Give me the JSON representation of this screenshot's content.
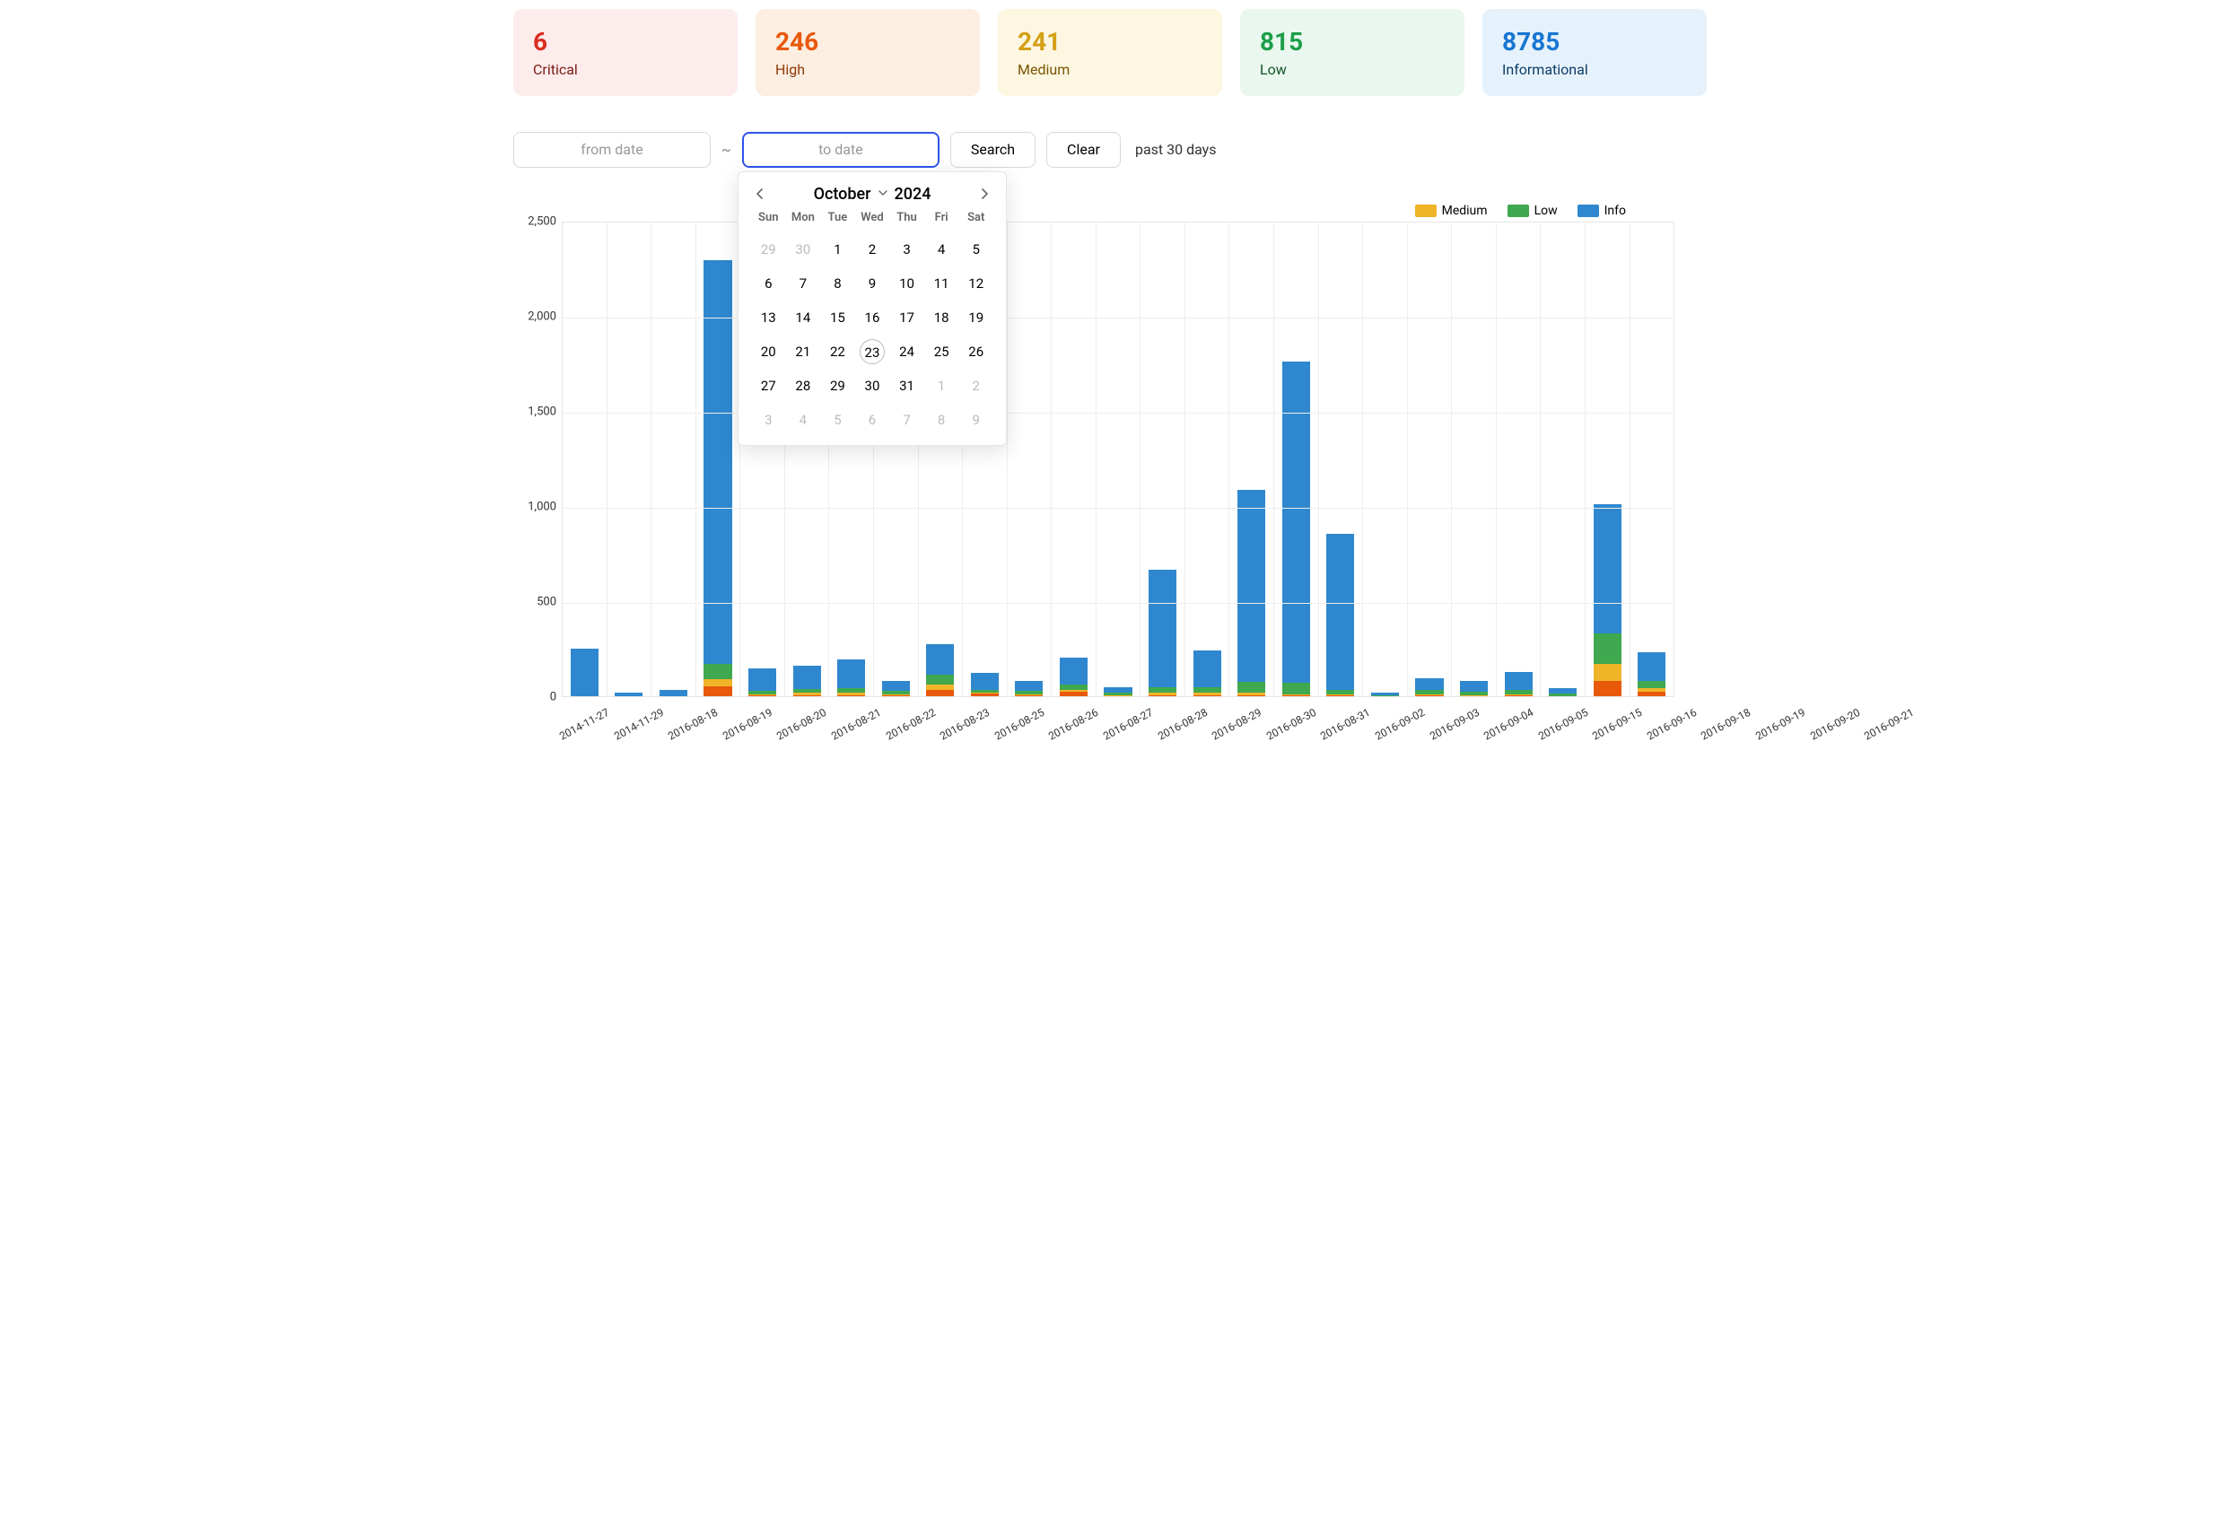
{
  "cards": [
    {
      "key": "critical",
      "num": "6",
      "label": "Critical"
    },
    {
      "key": "high",
      "num": "246",
      "label": "High"
    },
    {
      "key": "medium",
      "num": "241",
      "label": "Medium"
    },
    {
      "key": "low",
      "num": "815",
      "label": "Low"
    },
    {
      "key": "info",
      "num": "8785",
      "label": "Informational"
    }
  ],
  "controls": {
    "from_placeholder": "from date",
    "to_placeholder": "to date",
    "tilde": "~",
    "search": "Search",
    "clear": "Clear",
    "quick": "past 30 days"
  },
  "datepicker": {
    "month": "October",
    "year": "2024",
    "dow": [
      "Sun",
      "Mon",
      "Tue",
      "Wed",
      "Thu",
      "Fri",
      "Sat"
    ],
    "leading": [
      "29",
      "30"
    ],
    "days": [
      "1",
      "2",
      "3",
      "4",
      "5",
      "6",
      "7",
      "8",
      "9",
      "10",
      "11",
      "12",
      "13",
      "14",
      "15",
      "16",
      "17",
      "18",
      "19",
      "20",
      "21",
      "22",
      "23",
      "24",
      "25",
      "26",
      "27",
      "28",
      "29",
      "30",
      "31"
    ],
    "today": "23",
    "trailing": [
      "1",
      "2",
      "3",
      "4",
      "5",
      "6",
      "7",
      "8",
      "9"
    ]
  },
  "legend": {
    "medium": "Medium",
    "low": "Low",
    "info": "Info"
  },
  "chart_data": {
    "type": "bar",
    "ylabel": "",
    "xlabel": "",
    "ylim": [
      0,
      2500
    ],
    "yticks": [
      0,
      500,
      1000,
      1500,
      2000,
      2500
    ],
    "ytick_labels": [
      "0",
      "500",
      "1,000",
      "1,500",
      "2,000",
      "2,500"
    ],
    "categories": [
      "2014-11-27",
      "2014-11-29",
      "2016-08-18",
      "2016-08-19",
      "2016-08-20",
      "2016-08-21",
      "2016-08-22",
      "2016-08-23",
      "2016-08-25",
      "2016-08-26",
      "2016-08-27",
      "2016-08-28",
      "2016-08-29",
      "2016-08-30",
      "2016-08-31",
      "2016-09-02",
      "2016-09-03",
      "2016-09-04",
      "2016-09-05",
      "2016-09-15",
      "2016-09-16",
      "2016-09-18",
      "2016-09-19",
      "2016-09-20",
      "2016-09-21"
    ],
    "series": [
      {
        "name": "Critical",
        "key": "critical",
        "values": [
          0,
          0,
          0,
          0,
          0,
          0,
          0,
          0,
          0,
          0,
          0,
          0,
          0,
          0,
          0,
          0,
          0,
          0,
          0,
          0,
          0,
          0,
          0,
          0,
          0
        ]
      },
      {
        "name": "High",
        "key": "high",
        "values": [
          0,
          0,
          0,
          50,
          5,
          5,
          5,
          5,
          30,
          10,
          5,
          20,
          0,
          5,
          5,
          5,
          5,
          5,
          0,
          5,
          0,
          5,
          0,
          80,
          20
        ]
      },
      {
        "name": "Medium",
        "key": "medium",
        "values": [
          0,
          0,
          0,
          40,
          5,
          10,
          10,
          5,
          30,
          5,
          5,
          10,
          5,
          10,
          10,
          10,
          5,
          5,
          0,
          5,
          5,
          5,
          0,
          90,
          20
        ]
      },
      {
        "name": "Low",
        "key": "low",
        "values": [
          0,
          0,
          0,
          80,
          15,
          20,
          25,
          15,
          50,
          15,
          15,
          30,
          10,
          30,
          30,
          60,
          60,
          20,
          5,
          20,
          15,
          20,
          10,
          160,
          40
        ]
      },
      {
        "name": "Info",
        "key": "info",
        "values": [
          250,
          15,
          30,
          2120,
          120,
          125,
          150,
          55,
          160,
          90,
          55,
          140,
          30,
          620,
          195,
          1010,
          1690,
          820,
          10,
          65,
          60,
          95,
          30,
          680,
          150
        ]
      }
    ]
  }
}
